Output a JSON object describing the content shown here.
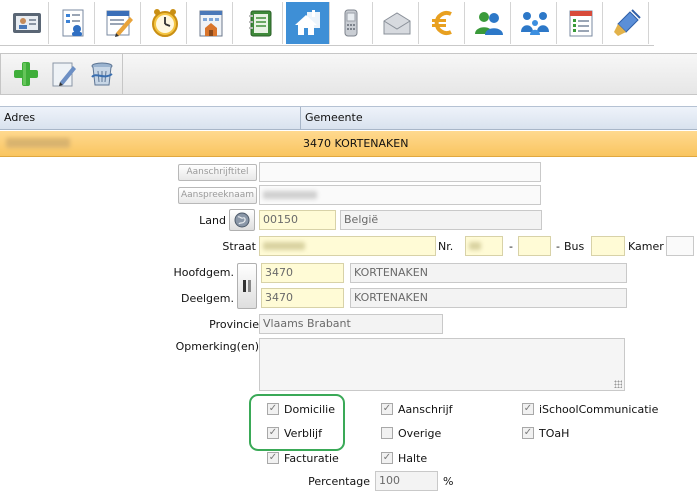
{
  "toolbar_icons": [
    "id-card-icon",
    "report-icon",
    "edit-form-icon",
    "clock-icon",
    "building-icon",
    "address-book-icon",
    "home-icon",
    "mobile-phone-icon",
    "envelope-icon",
    "euro-icon",
    "users-icon",
    "family-icon",
    "checklist-icon",
    "brush-icon"
  ],
  "active_toolbar_icon": "home-icon",
  "actions": [
    "add-icon",
    "edit-icon",
    "delete-icon"
  ],
  "grid": {
    "columns": [
      "Adres",
      "Gemeente"
    ],
    "rows": [
      {
        "adres": "",
        "gemeente": "3470 KORTENAKEN"
      }
    ]
  },
  "form": {
    "aanschrijftitel_btn": "Aanschrijftitel",
    "aanspreeknaam_btn": "Aanspreeknaam",
    "land_label": "Land",
    "land_code": "00150",
    "land_name": "België",
    "straat_label": "Straat",
    "nr_label": "Nr.",
    "dash1": "-",
    "dash2": "-",
    "bus_label": "Bus",
    "kamer_label": "Kamer",
    "hoofdgem_label": "Hoofdgem.",
    "hoofdgem_code": "3470",
    "hoofdgem_name": "KORTENAKEN",
    "deelgem_label": "Deelgem.",
    "deelgem_code": "3470",
    "deelgem_name": "KORTENAKEN",
    "provincie_label": "Provincie",
    "provincie_value": "Vlaams Brabant",
    "opmerking_label": "Opmerking(en)",
    "percentage_label": "Percentage",
    "percentage_value": "100",
    "percent_sign": "%"
  },
  "checkboxes": [
    {
      "label": "Domicilie",
      "checked": true
    },
    {
      "label": "Verblijf",
      "checked": true
    },
    {
      "label": "Facturatie",
      "checked": true
    },
    {
      "label": "Aanschrijf",
      "checked": true
    },
    {
      "label": "Overige",
      "checked": false
    },
    {
      "label": "Halte",
      "checked": true
    },
    {
      "label": "iSchoolCommunicatie",
      "checked": true
    },
    {
      "label": "TOaH",
      "checked": true
    }
  ],
  "colors": {
    "active_tab": "#3e8fd6",
    "selected_row": "#f9c560",
    "required_field": "#fffbd6",
    "highlight_ring": "#3aa957"
  }
}
